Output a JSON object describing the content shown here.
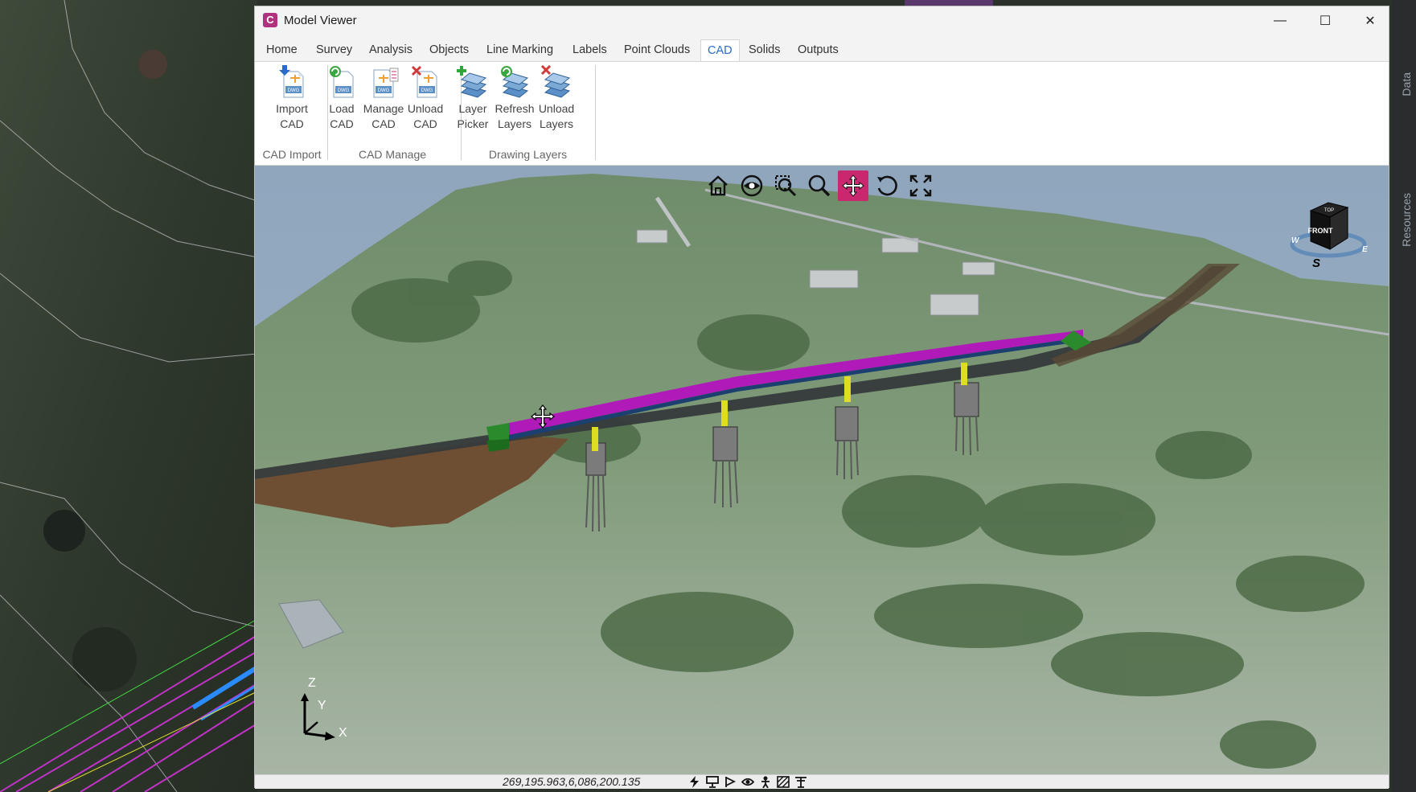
{
  "window": {
    "title": "Model Viewer"
  },
  "window_controls": {
    "minimize": "—",
    "maximize": "☐",
    "close": "✕"
  },
  "ribbon_tabs": [
    {
      "label": "Home"
    },
    {
      "label": "Survey"
    },
    {
      "label": "Analysis"
    },
    {
      "label": "Objects"
    },
    {
      "label": "Line Marking"
    },
    {
      "label": "Labels"
    },
    {
      "label": "Point Clouds"
    },
    {
      "label": "CAD"
    },
    {
      "label": "Solids"
    },
    {
      "label": "Outputs"
    }
  ],
  "active_tab": "CAD",
  "ribbon": {
    "buttons": [
      {
        "line1": "Import",
        "line2": "CAD",
        "icon": "import-cad-icon"
      },
      {
        "line1": "Load",
        "line2": "CAD",
        "icon": "load-cad-icon"
      },
      {
        "line1": "Manage",
        "line2": "CAD",
        "icon": "manage-cad-icon"
      },
      {
        "line1": "Unload",
        "line2": "CAD",
        "icon": "unload-cad-icon"
      },
      {
        "line1": "Layer",
        "line2": "Picker",
        "icon": "layer-picker-icon"
      },
      {
        "line1": "Refresh",
        "line2": "Layers",
        "icon": "refresh-layers-icon"
      },
      {
        "line1": "Unload",
        "line2": "Layers",
        "icon": "unload-layers-icon"
      }
    ],
    "groups": [
      "CAD Import",
      "CAD Manage",
      "Drawing Layers"
    ],
    "dwg_label": "DWG"
  },
  "nav_toolbar": {
    "tools": [
      "home-icon",
      "orbit-eye-icon",
      "zoom-window-icon",
      "zoom-icon",
      "pan-icon",
      "rotate-icon",
      "fit-extents-icon"
    ],
    "active": "pan-icon"
  },
  "viewcube": {
    "top": "TOP",
    "face": "FRONT",
    "west": "W",
    "east": "E",
    "south": "S"
  },
  "axis_triad": {
    "z": "Z",
    "y": "Y",
    "x": "X"
  },
  "statusbar": {
    "coords": "269,195.963,6,086,200.135",
    "icons": [
      "lightning-icon",
      "presentation-icon",
      "play-flag-icon",
      "eye-icon",
      "person-icon",
      "hatch-icon",
      "section-icon"
    ]
  },
  "right_panel": {
    "tab1": "Data",
    "tab2": "Resources"
  },
  "colors": {
    "accent": "#c9286e",
    "tab_active": "#2a6cc5",
    "road_top": "#b01ab8",
    "road_deck": "#3c3c3c",
    "embankment": "#6f4f33",
    "piers": "#dddd22"
  }
}
